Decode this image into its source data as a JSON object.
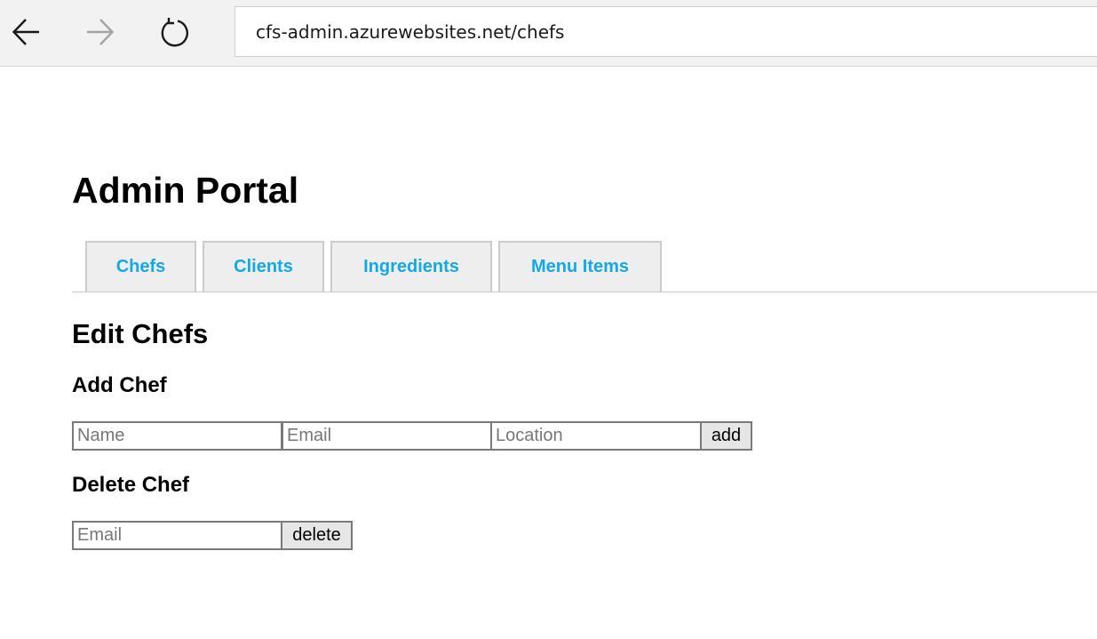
{
  "browser": {
    "url": "cfs-admin.azurewebsites.net/chefs",
    "back_icon": "arrow-left",
    "forward_icon": "arrow-right",
    "refresh_icon": "refresh"
  },
  "page": {
    "title": "Admin Portal",
    "tabs": [
      {
        "label": "Chefs"
      },
      {
        "label": "Clients"
      },
      {
        "label": "Ingredients"
      },
      {
        "label": "Menu Items"
      }
    ],
    "section_title": "Edit Chefs",
    "add_chef": {
      "heading": "Add Chef",
      "name_placeholder": "Name",
      "email_placeholder": "Email",
      "location_placeholder": "Location",
      "button_label": "add"
    },
    "delete_chef": {
      "heading": "Delete Chef",
      "email_placeholder": "Email",
      "button_label": "delete"
    }
  },
  "colors": {
    "tab_text": "#14a8e8",
    "tab_bg": "#eeeeee",
    "toolbar_bg": "#f2f2f2"
  }
}
